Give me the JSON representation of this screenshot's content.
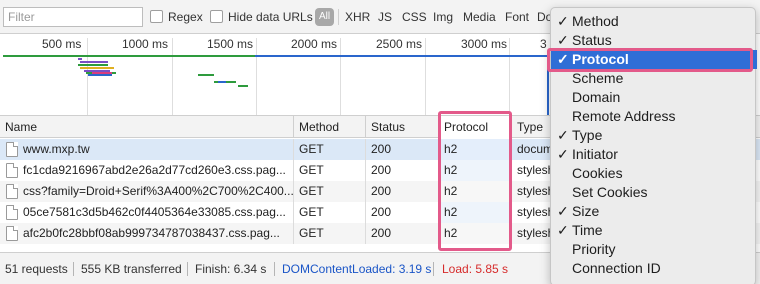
{
  "filter_bar": {
    "filter_placeholder": "Filter",
    "regex_label": "Regex",
    "hide_data_urls_label": "Hide data URLs",
    "all_label": "All",
    "types": [
      "XHR",
      "JS",
      "CSS",
      "Img",
      "Media",
      "Font",
      "Do"
    ]
  },
  "overview": {
    "tick_labels": [
      "500 ms",
      "1000 ms",
      "1500 ms",
      "2000 ms",
      "2500 ms",
      "3000 ms",
      "3"
    ]
  },
  "table": {
    "headers": {
      "name": "Name",
      "method": "Method",
      "status": "Status",
      "protocol": "Protocol",
      "type": "Type"
    },
    "rows": [
      {
        "name": "www.mxp.tw",
        "method": "GET",
        "status": "200",
        "protocol": "h2",
        "type": "docum"
      },
      {
        "name": "fc1cda9216967abd2e26a2d77cd260e3.css.pag...",
        "method": "GET",
        "status": "200",
        "protocol": "h2",
        "type": "stylesh"
      },
      {
        "name": "css?family=Droid+Serif%3A400%2C700%2C400...",
        "method": "GET",
        "status": "200",
        "protocol": "h2",
        "type": "stylesh"
      },
      {
        "name": "05ce7581c3d5b462c0f4405364e33085.css.pag...",
        "method": "GET",
        "status": "200",
        "protocol": "h2",
        "type": "stylesh"
      },
      {
        "name": "afc2b0fc28bbf08ab999734787038437.css.pag...",
        "method": "GET",
        "status": "200",
        "protocol": "h2",
        "type": "stylesh"
      }
    ]
  },
  "status_bar": {
    "requests": "51 requests",
    "transferred": "555 KB transferred",
    "finish": "Finish: 6.34 s",
    "dom_content_loaded": "DOMContentLoaded: 3.19 s",
    "load": "Load: 5.85 s",
    "dom_color": "#1a55c7",
    "load_color": "#d62b2b"
  },
  "context_menu": {
    "items": [
      {
        "label": "Method",
        "checked": true
      },
      {
        "label": "Status",
        "checked": true
      },
      {
        "label": "Protocol",
        "checked": true,
        "highlighted": true
      },
      {
        "label": "Scheme",
        "checked": false
      },
      {
        "label": "Domain",
        "checked": false
      },
      {
        "label": "Remote Address",
        "checked": false
      },
      {
        "label": "Type",
        "checked": true
      },
      {
        "label": "Initiator",
        "checked": true
      },
      {
        "label": "Cookies",
        "checked": false
      },
      {
        "label": "Set Cookies",
        "checked": false
      },
      {
        "label": "Size",
        "checked": true
      },
      {
        "label": "Time",
        "checked": true
      },
      {
        "label": "Priority",
        "checked": false
      },
      {
        "label": "Connection ID",
        "checked": false
      }
    ],
    "check_glyph": "✓"
  },
  "colors": {
    "accent": "#2f6ed6",
    "highlight_frame": "#e35a8a",
    "selected_row": "#dbe8f7"
  }
}
